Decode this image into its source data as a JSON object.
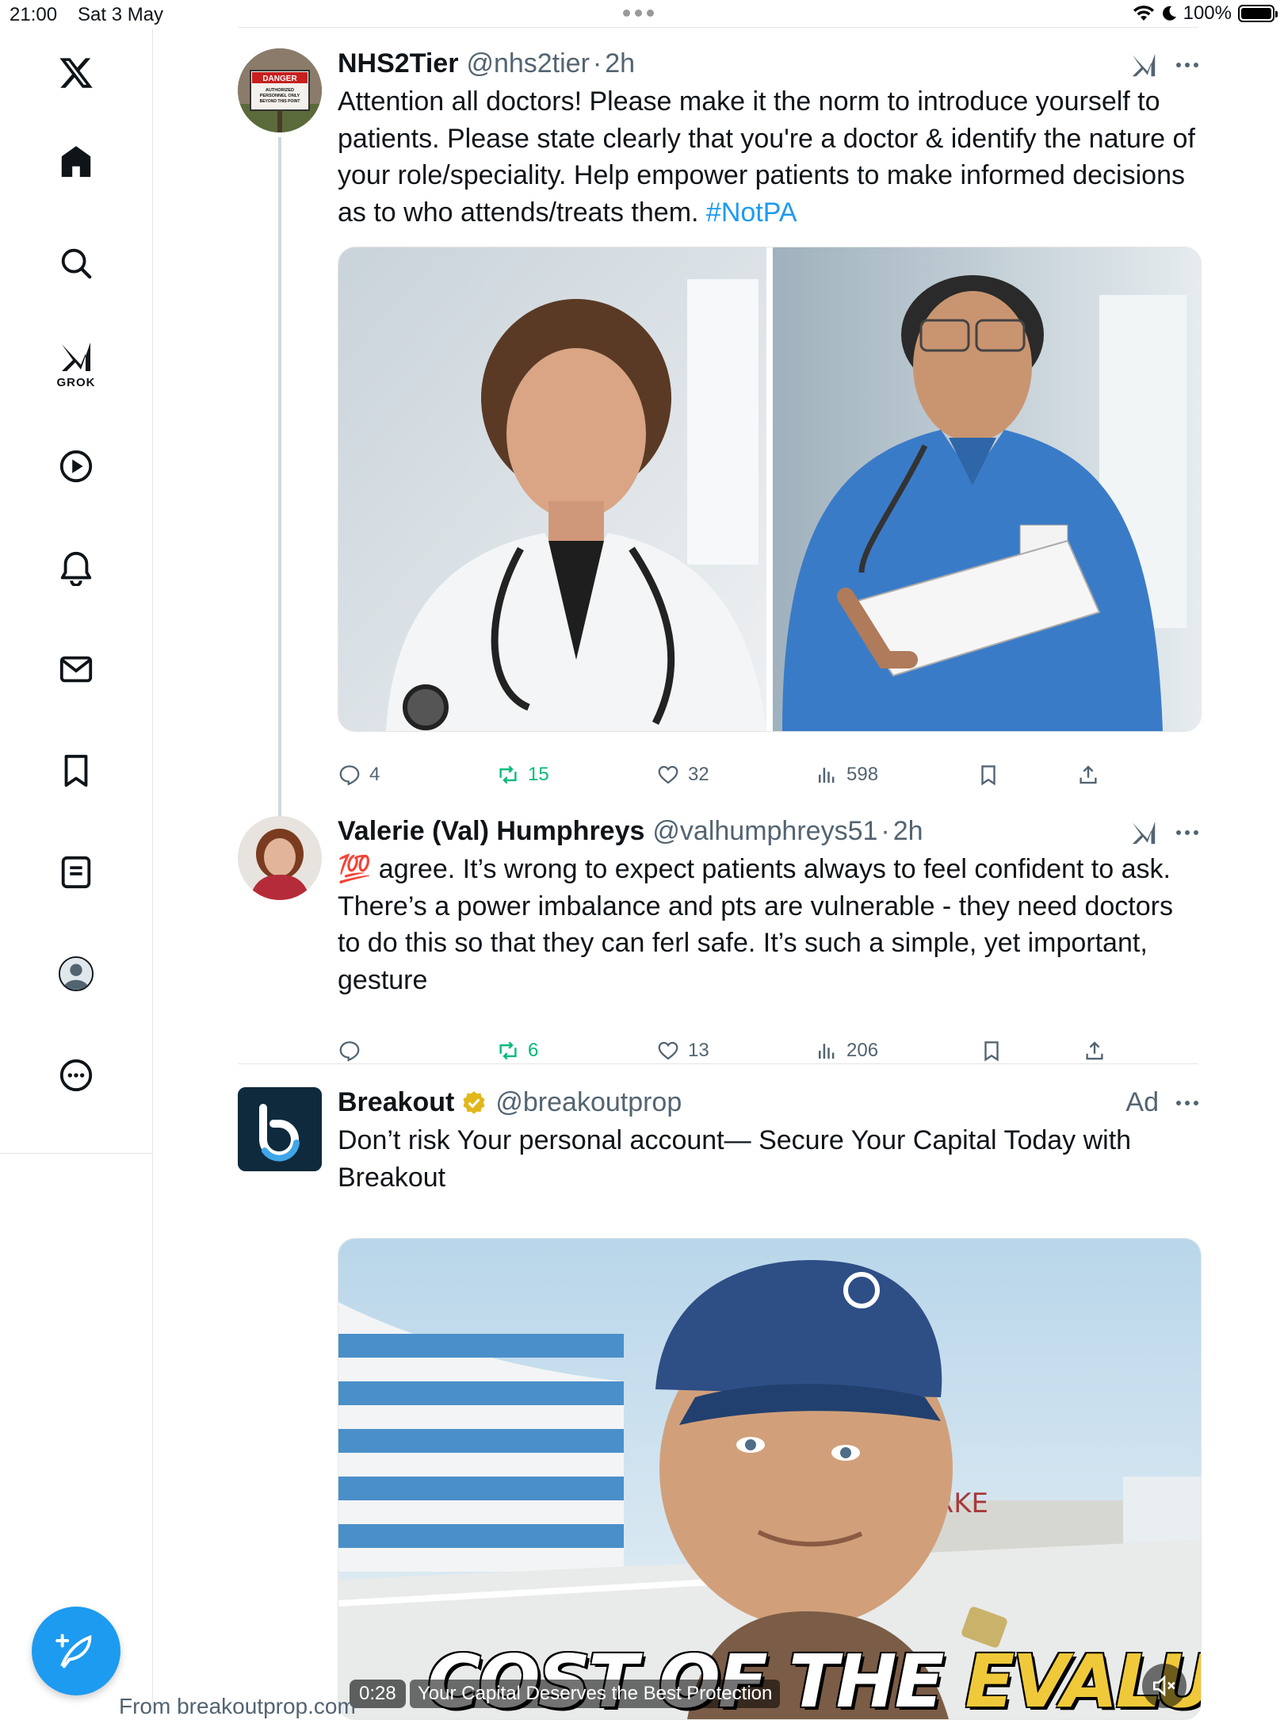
{
  "status_bar": {
    "time": "21:00",
    "date": "Sat 3 May",
    "battery": "100%",
    "battery_level": 1.0
  },
  "posts": [
    {
      "name": "NHS2Tier",
      "handle": "@nhs2tier",
      "dot": "·",
      "time": "2h",
      "text": "Attention all doctors! Please make it the norm to introduce yourself to patients. Please state clearly that you're a doctor & identify the nature of your role/speciality. Help empower patients to make informed decisions as to who attends/treats them. ",
      "hashtag": "#NotPA",
      "avatar_sign": {
        "line1": "DANGER",
        "line2": "AUTHORIZED",
        "line3": "PERSONNEL ONLY",
        "line4": "BEYOND THIS POINT"
      },
      "replies": "4",
      "reposts": "15",
      "likes": "32",
      "views": "598"
    },
    {
      "name": "Valerie (Val) Humphreys",
      "handle": "@valhumphreys51",
      "dot": "·",
      "time": "2h",
      "text": "💯 agree. It’s wrong to expect patients always to feel confident to ask. There’s a power imbalance and pts are vulnerable - they need doctors to do this so that they can ferl safe. It’s such a simple, yet important, gesture",
      "replies": "",
      "reposts": "6",
      "likes": "13",
      "views": "206"
    },
    {
      "name": "Breakout",
      "handle": "@breakoutprop",
      "ad_label": "Ad",
      "text": "Don’t risk Your personal account— Secure Your Capital Today with Breakout",
      "video_time": "0:28",
      "video_cta": "Your Capital Deserves the Best Protection",
      "video_caption_a": "COST OF THE ",
      "video_caption_b": "EVALUATION",
      "video_sign": "MARKE",
      "from": "From breakoutprop.com"
    }
  ],
  "icons": {
    "sidebar": [
      "x-logo-icon",
      "home-icon",
      "search-icon",
      "grok-icon",
      "video-icon",
      "notifications-icon",
      "messages-icon",
      "bookmarks-icon",
      "lists-icon",
      "profile-icon",
      "more-icon"
    ],
    "grok_label": "GROK"
  },
  "colors": {
    "accent": "#1d9bf0",
    "repost_green": "#00ba7c",
    "muted": "#536471",
    "verified_gold": "#e2b719",
    "breakout_bg": "#0f2a3d"
  }
}
